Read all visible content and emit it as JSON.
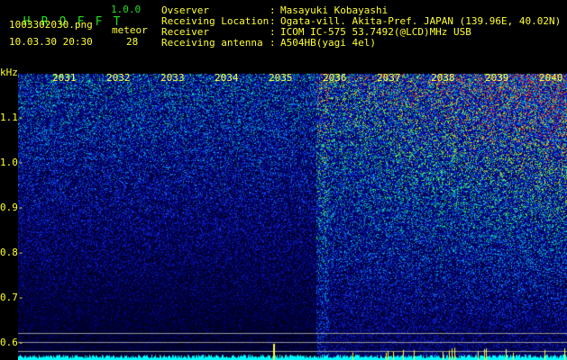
{
  "header": {
    "logo_letters": [
      "H",
      "R",
      "O",
      "F",
      "F",
      "T"
    ],
    "logo": "HROFFT",
    "version": "1.0.0",
    "filename": "1003302030.png",
    "datetime": "10.03.30 20:30",
    "meteor_label": "meteor",
    "meteor_count": "28"
  },
  "info": [
    {
      "label": "Ovserver",
      "value": "Masayuki Kobayashi"
    },
    {
      "label": "Receiving Location",
      "value": "Ogata-vill. Akita-Pref. JAPAN (139.96E, 40.02N)"
    },
    {
      "label": "Receiver",
      "value": "ICOM IC-575 53.7492(@LCD)MHz USB"
    },
    {
      "label": "Receiving antenna",
      "value": "A504HB(yagi 4el)"
    }
  ],
  "axis": {
    "unit": "kHz",
    "freq_labels": [
      "1.1",
      "1.0",
      "0.9",
      "0.8",
      "0.7",
      "0.6"
    ],
    "time_labels": [
      "2031",
      "2032",
      "2033",
      "2034",
      "2035",
      "2036",
      "2037",
      "2038",
      "2039",
      "2040"
    ]
  },
  "colors": {
    "text": "#ffff33",
    "logo": "#22dd22",
    "bars": "#00ffff"
  }
}
